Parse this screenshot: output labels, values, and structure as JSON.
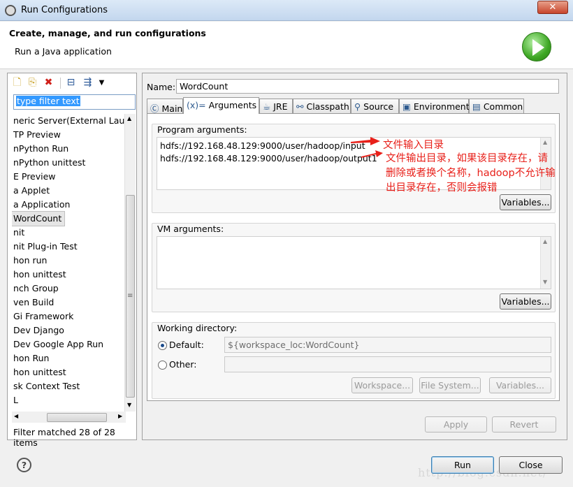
{
  "window": {
    "title": "Run Configurations",
    "close_glyph": "✕"
  },
  "header": {
    "title": "Create, manage, and run configurations",
    "subtitle": "Run a Java application",
    "logo_icon": "run-logo-icon"
  },
  "left": {
    "toolbar_icons": [
      "new-config-icon",
      "duplicate-icon",
      "delete-icon",
      "collapse-all-icon",
      "filter-icon",
      "menu-dropdown-icon"
    ],
    "filter": {
      "text": "type filter text"
    },
    "tree": [
      "neric Server(External Launch",
      "TP Preview",
      "nPython Run",
      "nPython unittest",
      "E Preview",
      "a Applet",
      "a Application",
      "WordCount",
      "nit",
      "nit Plug-in Test",
      "hon run",
      "hon unittest",
      "nch Group",
      "ven Build",
      "Gi Framework",
      "Dev Django",
      "Dev Google App Run",
      "hon Run",
      "hon unittest",
      "sk Context Test",
      "L"
    ],
    "selected_index": 7,
    "status": "Filter matched 28 of 28 items",
    "scroll_glyphs": {
      "up": "▲",
      "down": "▼",
      "left": "◀",
      "right": "▶",
      "grip": "≡"
    }
  },
  "config": {
    "name_label": "Name:",
    "name_value": "WordCount",
    "tabs": [
      {
        "label": "Main",
        "icon": "main-tab-icon",
        "glyph": "Ⓒ"
      },
      {
        "label": "Arguments",
        "icon": "arguments-tab-icon",
        "glyph": "(x)="
      },
      {
        "label": "JRE",
        "icon": "jre-tab-icon",
        "glyph": "☕"
      },
      {
        "label": "Classpath",
        "icon": "classpath-tab-icon",
        "glyph": "⚯"
      },
      {
        "label": "Source",
        "icon": "source-tab-icon",
        "glyph": "⚲"
      },
      {
        "label": "Environment",
        "icon": "environment-tab-icon",
        "glyph": "▣"
      },
      {
        "label": "Common",
        "icon": "common-tab-icon",
        "glyph": "▤"
      }
    ],
    "active_tab": "Arguments",
    "program_args": {
      "label": "Program arguments:",
      "lines": [
        "hdfs://192.168.48.129:9000/user/hadoop/input",
        "hdfs://192.168.48.129:9000/user/hadoop/output1"
      ],
      "variables_button": "Variables..."
    },
    "vm_args": {
      "label": "VM arguments:",
      "value": "",
      "variables_button": "Variables..."
    },
    "working_dir": {
      "label": "Working directory:",
      "default_label": "Default:",
      "default_value": "${workspace_loc:WordCount}",
      "other_label": "Other:",
      "other_value": "",
      "selected": "Default",
      "buttons": [
        "Workspace...",
        "File System...",
        "Variables..."
      ]
    },
    "apply_button": "Apply",
    "revert_button": "Revert"
  },
  "annotations": {
    "input_note": "文件输入目录",
    "output_note_lines": [
      "文件输出目录，如果该目录存在，请",
      "删除或者换个名称，hadoop不允许输",
      "出目录存在，否则会报错"
    ],
    "color": "#e8201a"
  },
  "footer": {
    "help_glyph": "?",
    "run_button": "Run",
    "close_button": "Close",
    "watermark": "http://blog.csdn.net/"
  }
}
